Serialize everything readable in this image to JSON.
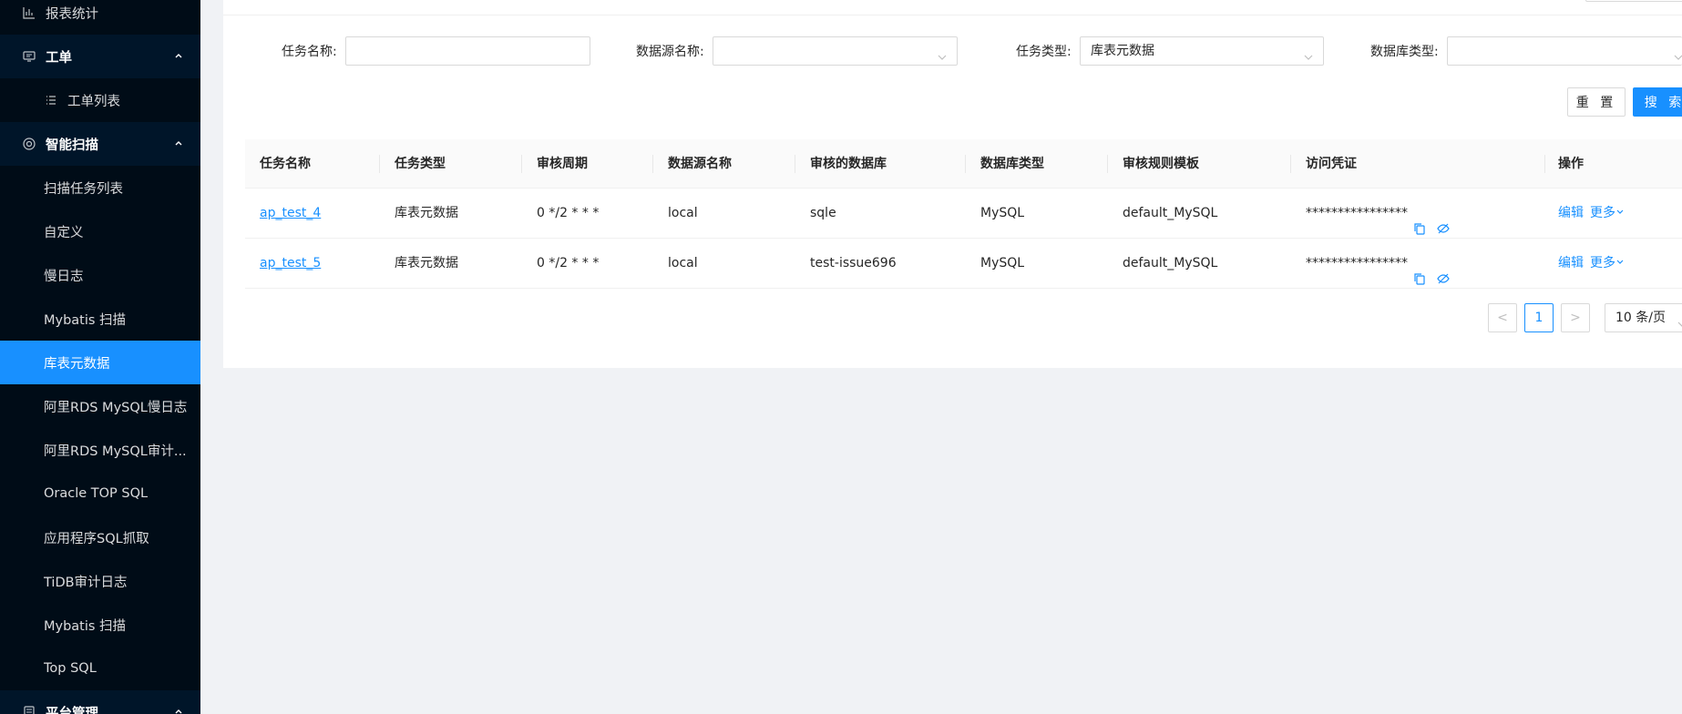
{
  "sidebar": {
    "items": [
      {
        "label": "报表统计",
        "icon": "bar-chart-icon"
      },
      {
        "label": "工单",
        "icon": "monitor-icon"
      },
      {
        "label": "工单列表",
        "icon": "list-icon"
      },
      {
        "label": "智能扫描",
        "icon": "scan-icon"
      },
      {
        "label": "扫描任务列表"
      },
      {
        "label": "自定义"
      },
      {
        "label": "慢日志"
      },
      {
        "label": "Mybatis 扫描"
      },
      {
        "label": "库表元数据"
      },
      {
        "label": "阿里RDS MySQL慢日志"
      },
      {
        "label": "阿里RDS MySQL审计..."
      },
      {
        "label": "Oracle TOP SQL"
      },
      {
        "label": "应用程序SQL抓取"
      },
      {
        "label": "TiDB审计日志"
      },
      {
        "label": "Mybatis 扫描"
      },
      {
        "label": "Top SQL"
      },
      {
        "label": "平台管理",
        "icon": "platform-icon"
      }
    ]
  },
  "filters": {
    "task_name_label": "任务名称:",
    "task_name_value": "",
    "datasource_label": "数据源名称:",
    "datasource_value": "",
    "task_type_label": "任务类型:",
    "task_type_value": "库表元数据",
    "db_type_label": "数据库类型:",
    "db_type_value": ""
  },
  "buttons": {
    "reset": "重 置",
    "search": "搜 索"
  },
  "table": {
    "columns": [
      "任务名称",
      "任务类型",
      "审核周期",
      "数据源名称",
      "审核的数据库",
      "数据库类型",
      "审核规则模板",
      "访问凭证",
      "操作"
    ],
    "rows": [
      {
        "name": "ap_test_4",
        "type": "库表元数据",
        "cron": "0 */2 * * *",
        "datasource": "local",
        "database": "sqle",
        "db_type": "MySQL",
        "template": "default_MySQL",
        "credential": "****************",
        "edit": "编辑",
        "more": "更多"
      },
      {
        "name": "ap_test_5",
        "type": "库表元数据",
        "cron": "0 */2 * * *",
        "datasource": "local",
        "database": "test-issue696",
        "db_type": "MySQL",
        "template": "default_MySQL",
        "credential": "****************",
        "edit": "编辑",
        "more": "更多"
      }
    ]
  },
  "pagination": {
    "prev": "<",
    "current": "1",
    "next": ">",
    "page_size": "10 条/页"
  },
  "colors": {
    "sidebar_bg": "#001529",
    "sidebar_sub_bg": "#000c17",
    "accent": "#1890ff"
  }
}
